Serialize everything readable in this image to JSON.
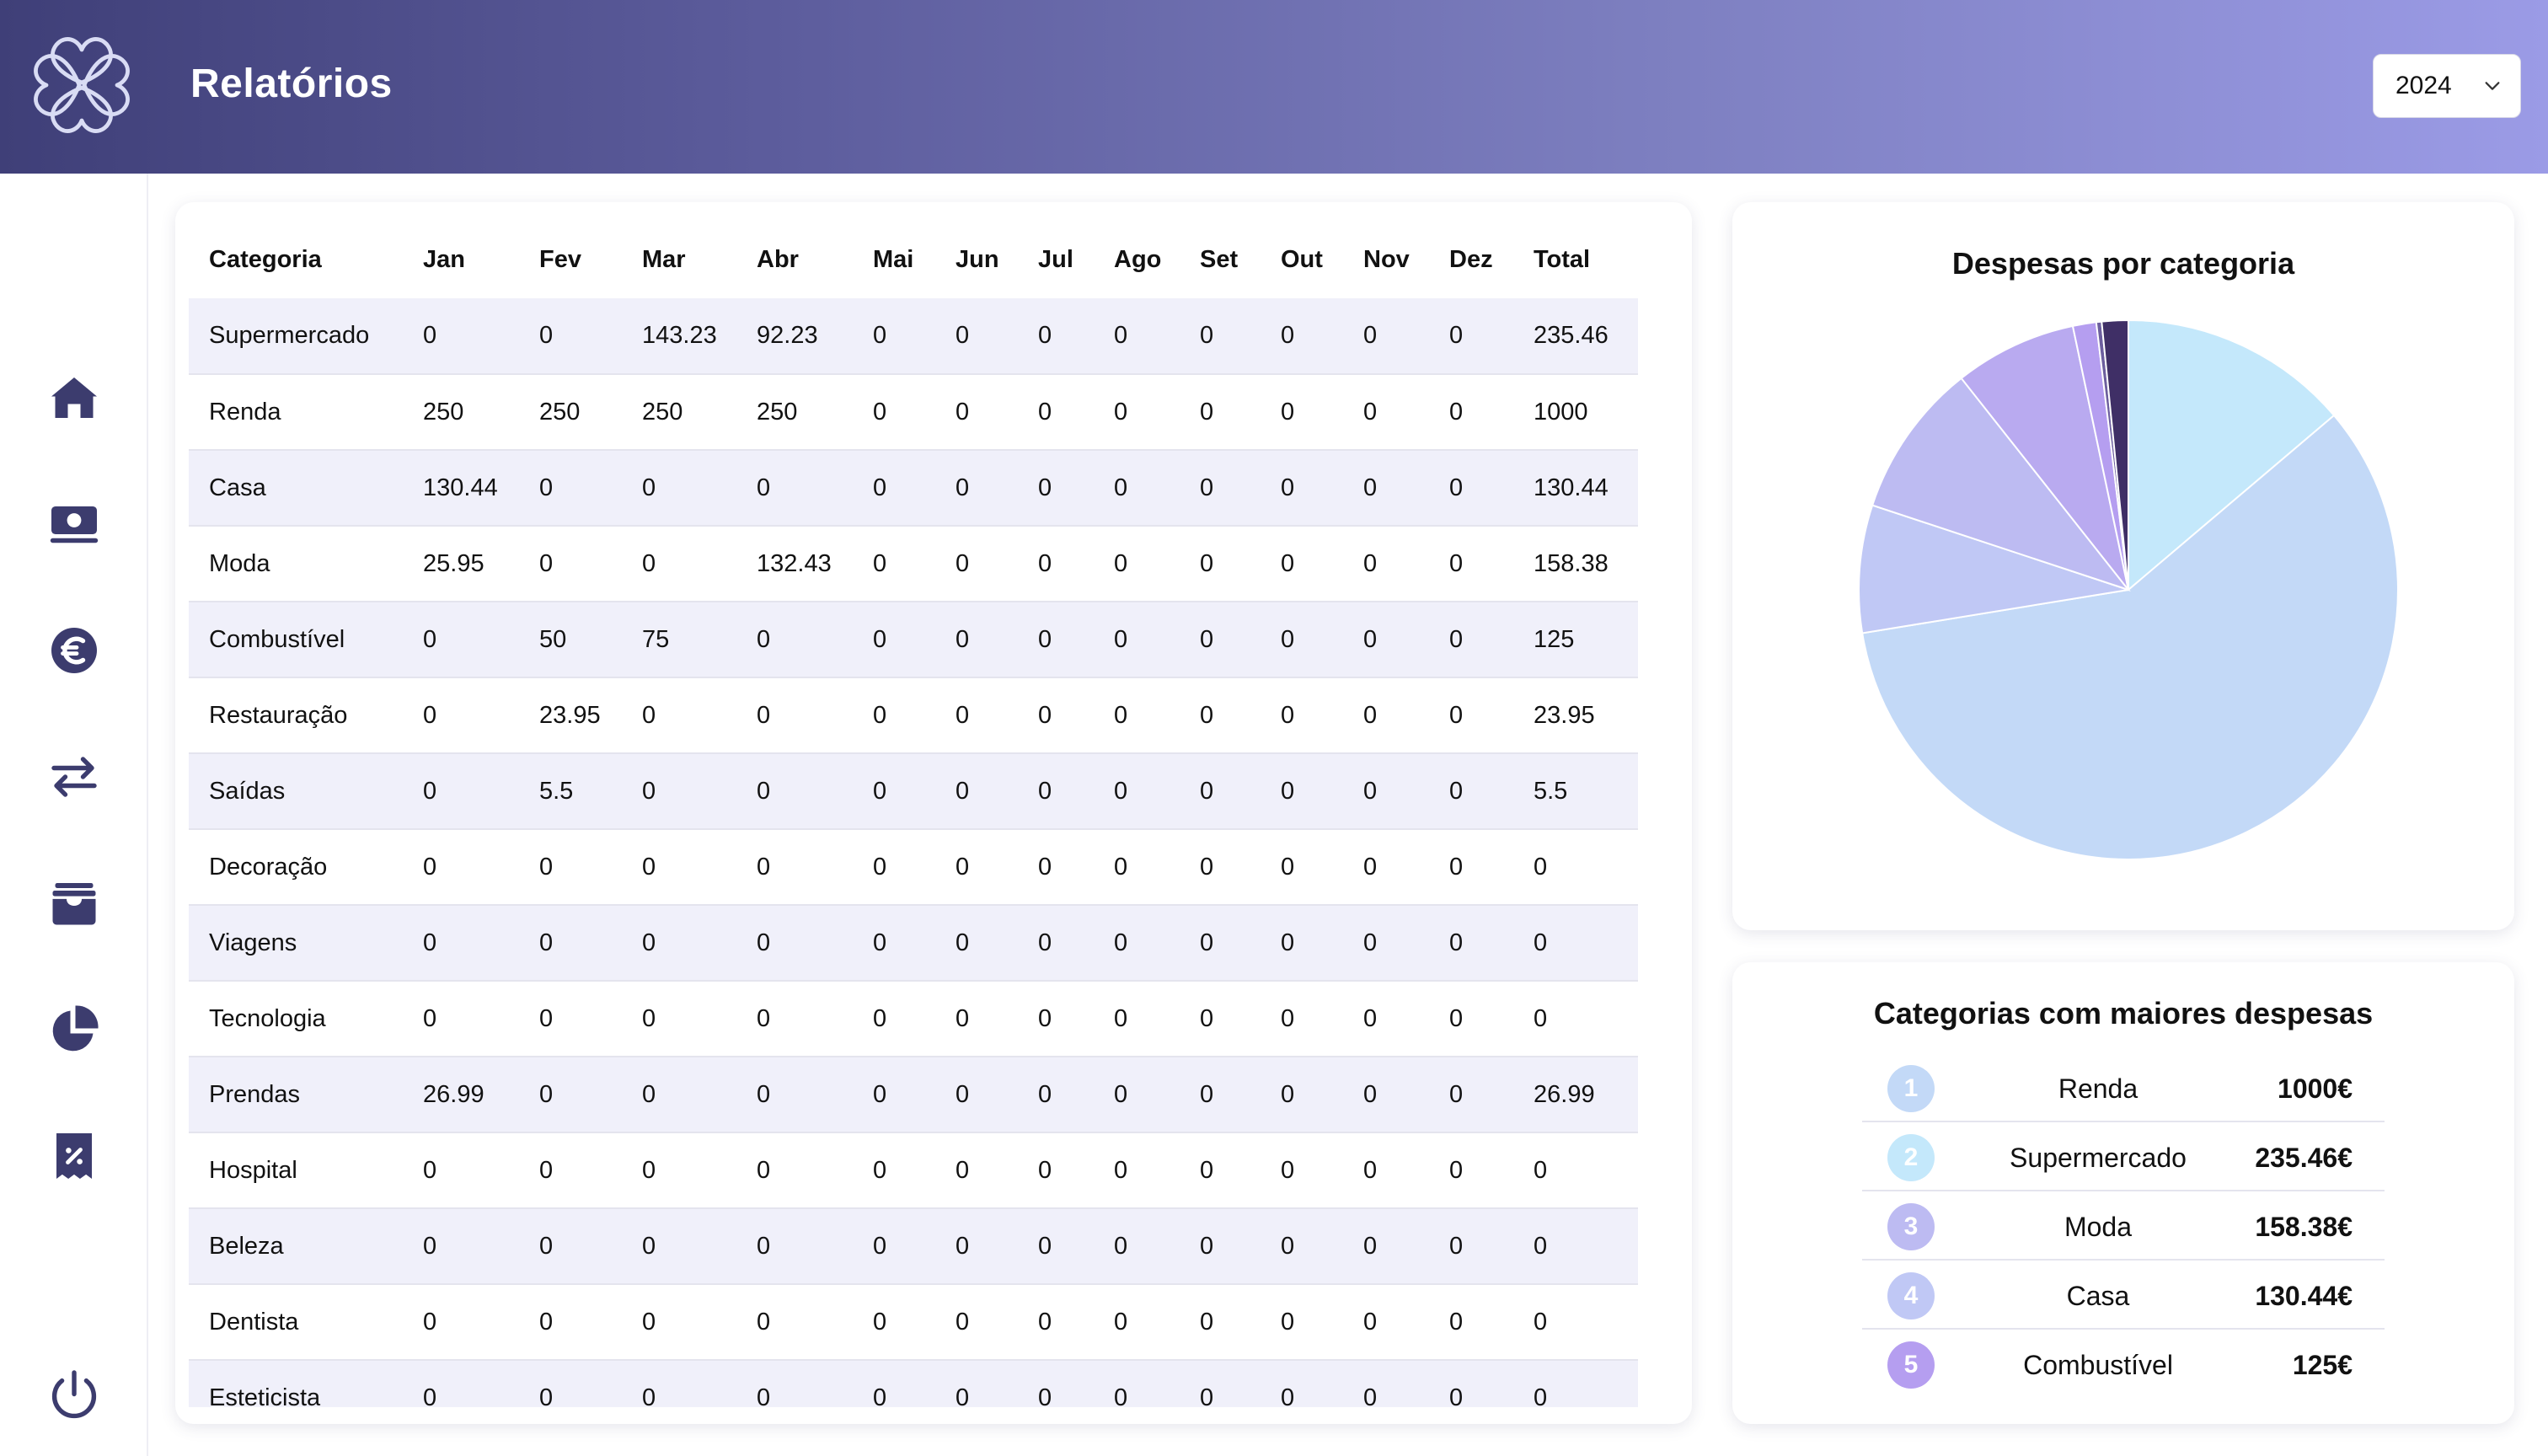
{
  "header": {
    "title": "Relatórios",
    "year_select": {
      "value": "2024",
      "icon": "chevron-down-icon"
    },
    "logo_icon": "four-leaf-clover-logo"
  },
  "sidebar": {
    "items": [
      {
        "name": "home",
        "icon": "home-icon"
      },
      {
        "name": "cash",
        "icon": "cash-icon"
      },
      {
        "name": "euro",
        "icon": "euro-icon"
      },
      {
        "name": "transfers",
        "icon": "arrows-exchange-icon"
      },
      {
        "name": "archive",
        "icon": "archive-box-icon"
      },
      {
        "name": "reports",
        "icon": "pie-chart-icon"
      },
      {
        "name": "discounts",
        "icon": "percent-receipt-icon"
      },
      {
        "name": "logout",
        "icon": "power-icon"
      }
    ],
    "icon_color": "#3c3c6e"
  },
  "table": {
    "headers": [
      "Categoria",
      "Jan",
      "Fev",
      "Mar",
      "Abr",
      "Mai",
      "Jun",
      "Jul",
      "Ago",
      "Set",
      "Out",
      "Nov",
      "Dez",
      "Total"
    ],
    "rows": [
      [
        "Supermercado",
        "0",
        "0",
        "143.23",
        "92.23",
        "0",
        "0",
        "0",
        "0",
        "0",
        "0",
        "0",
        "0",
        "235.46"
      ],
      [
        "Renda",
        "250",
        "250",
        "250",
        "250",
        "0",
        "0",
        "0",
        "0",
        "0",
        "0",
        "0",
        "0",
        "1000"
      ],
      [
        "Casa",
        "130.44",
        "0",
        "0",
        "0",
        "0",
        "0",
        "0",
        "0",
        "0",
        "0",
        "0",
        "0",
        "130.44"
      ],
      [
        "Moda",
        "25.95",
        "0",
        "0",
        "132.43",
        "0",
        "0",
        "0",
        "0",
        "0",
        "0",
        "0",
        "0",
        "158.38"
      ],
      [
        "Combustível",
        "0",
        "50",
        "75",
        "0",
        "0",
        "0",
        "0",
        "0",
        "0",
        "0",
        "0",
        "0",
        "125"
      ],
      [
        "Restauração",
        "0",
        "23.95",
        "0",
        "0",
        "0",
        "0",
        "0",
        "0",
        "0",
        "0",
        "0",
        "0",
        "23.95"
      ],
      [
        "Saídas",
        "0",
        "5.5",
        "0",
        "0",
        "0",
        "0",
        "0",
        "0",
        "0",
        "0",
        "0",
        "0",
        "5.5"
      ],
      [
        "Decoração",
        "0",
        "0",
        "0",
        "0",
        "0",
        "0",
        "0",
        "0",
        "0",
        "0",
        "0",
        "0",
        "0"
      ],
      [
        "Viagens",
        "0",
        "0",
        "0",
        "0",
        "0",
        "0",
        "0",
        "0",
        "0",
        "0",
        "0",
        "0",
        "0"
      ],
      [
        "Tecnologia",
        "0",
        "0",
        "0",
        "0",
        "0",
        "0",
        "0",
        "0",
        "0",
        "0",
        "0",
        "0",
        "0"
      ],
      [
        "Prendas",
        "26.99",
        "0",
        "0",
        "0",
        "0",
        "0",
        "0",
        "0",
        "0",
        "0",
        "0",
        "0",
        "26.99"
      ],
      [
        "Hospital",
        "0",
        "0",
        "0",
        "0",
        "0",
        "0",
        "0",
        "0",
        "0",
        "0",
        "0",
        "0",
        "0"
      ],
      [
        "Beleza",
        "0",
        "0",
        "0",
        "0",
        "0",
        "0",
        "0",
        "0",
        "0",
        "0",
        "0",
        "0",
        "0"
      ],
      [
        "Dentista",
        "0",
        "0",
        "0",
        "0",
        "0",
        "0",
        "0",
        "0",
        "0",
        "0",
        "0",
        "0",
        "0"
      ],
      [
        "Esteticista",
        "0",
        "0",
        "0",
        "0",
        "0",
        "0",
        "0",
        "0",
        "0",
        "0",
        "0",
        "0",
        "0"
      ]
    ]
  },
  "pie_chart": {
    "title": "Despesas por categoria"
  },
  "chart_data": {
    "type": "pie",
    "title": "Despesas por categoria",
    "categories": [
      "Supermercado",
      "Renda",
      "Casa",
      "Moda",
      "Combustível",
      "Restauração",
      "Saídas",
      "Prendas"
    ],
    "values": [
      235.46,
      1000,
      130.44,
      158.38,
      125,
      23.95,
      5.5,
      26.99
    ],
    "colors": [
      "#c4e8fb",
      "#c3d9f7",
      "#c0c8f5",
      "#bdbbf2",
      "#b9aaf0",
      "#b59ef0",
      "#6c5e9e",
      "#3f2f66"
    ]
  },
  "top_categories": {
    "title": "Categorias com maiores despesas",
    "items": [
      {
        "rank": "1",
        "name": "Renda",
        "amount": "1000€",
        "color": "#c3d9f7"
      },
      {
        "rank": "2",
        "name": "Supermercado",
        "amount": "235.46€",
        "color": "#c4e8fb"
      },
      {
        "rank": "3",
        "name": "Moda",
        "amount": "158.38€",
        "color": "#bdbbf2"
      },
      {
        "rank": "4",
        "name": "Casa",
        "amount": "130.44€",
        "color": "#c0c8f5"
      },
      {
        "rank": "5",
        "name": "Combustível",
        "amount": "125€",
        "color": "#b59ef0"
      }
    ]
  }
}
